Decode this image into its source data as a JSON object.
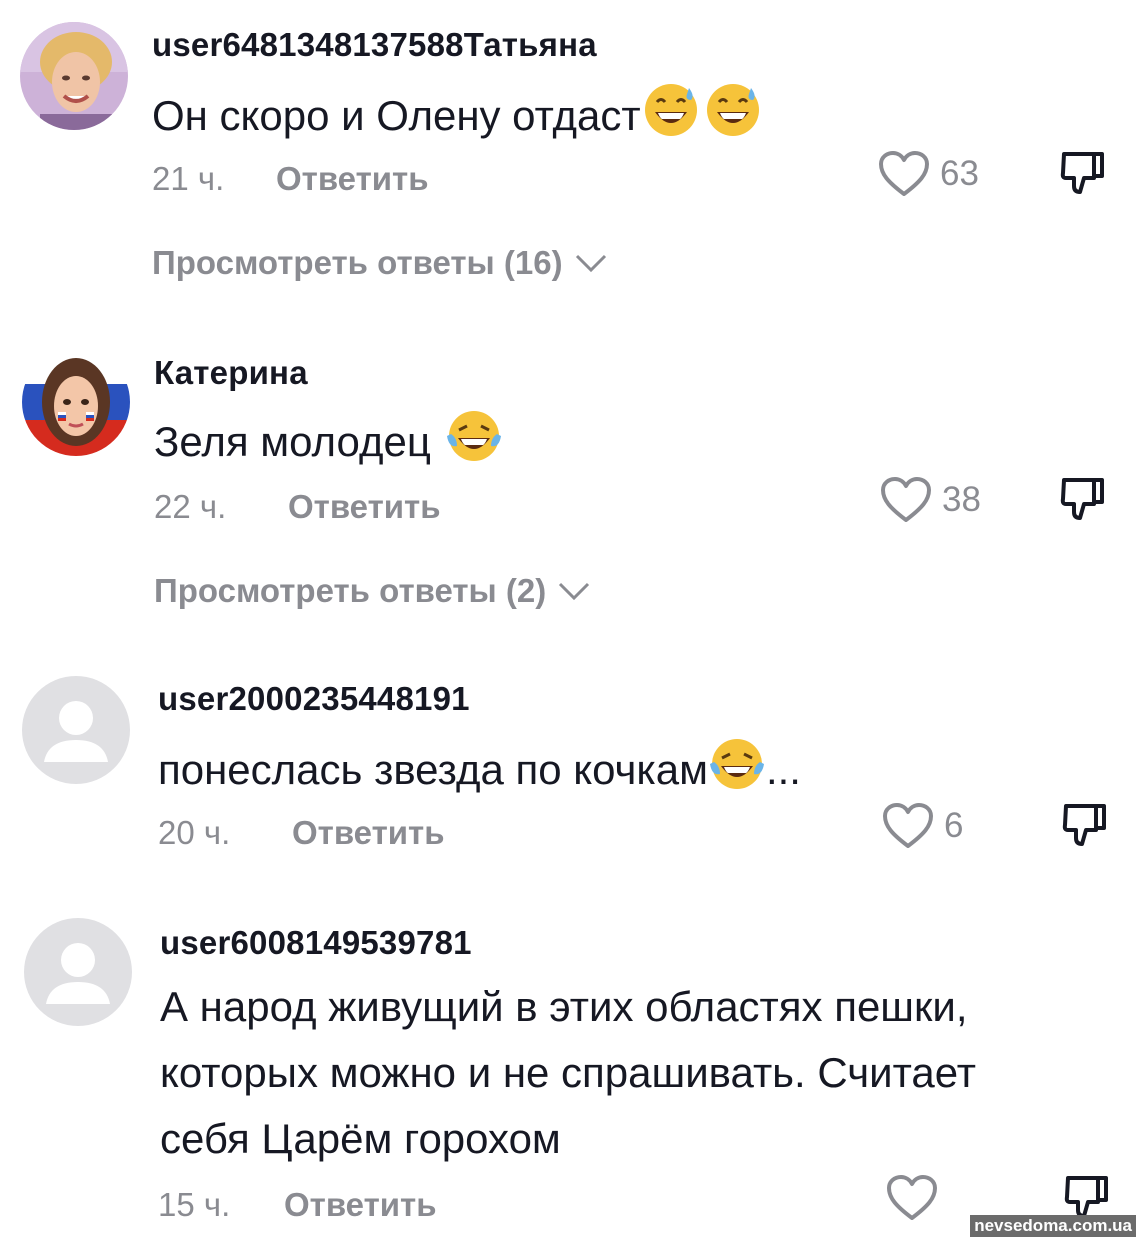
{
  "comments": [
    {
      "username": "user6481348137588Татьяна",
      "text": "Он скоро и Олену отдаст",
      "emojis": [
        "sweat-smile",
        "sweat-smile"
      ],
      "emoji_trailer": "",
      "time": "21 ч.",
      "reply_label": "Ответить",
      "likes": "63",
      "view_replies": "Просмотреть ответы (16)",
      "avatar": "photo-woman-blonde"
    },
    {
      "username": "Катерина",
      "text": "Зеля молодец",
      "emojis": [
        "tears-of-joy"
      ],
      "emoji_trailer": "",
      "time": "22 ч.",
      "reply_label": "Ответить",
      "likes": "38",
      "view_replies": "Просмотреть ответы (2)",
      "avatar": "cartoon-woman-flag"
    },
    {
      "username": "user2000235448191",
      "text": "понеслась звезда по кочкам",
      "emojis": [
        "tears-of-joy"
      ],
      "emoji_trailer": "...",
      "time": "20 ч.",
      "reply_label": "Ответить",
      "likes": "6",
      "view_replies": "",
      "avatar": "default"
    },
    {
      "username": "user6008149539781",
      "text_lines": [
        "А народ живущий в этих областях пешки,",
        "которых можно и не спрашивать. Считает",
        "себя Царём горохом"
      ],
      "time": "15 ч.",
      "reply_label": "Ответить",
      "likes": "",
      "view_replies": "",
      "avatar": "default"
    }
  ],
  "watermark": "nevsedoma.com.ua",
  "colors": {
    "text": "#161823",
    "muted": "#8a8b91",
    "avatar_default": "#e0e0e3"
  }
}
